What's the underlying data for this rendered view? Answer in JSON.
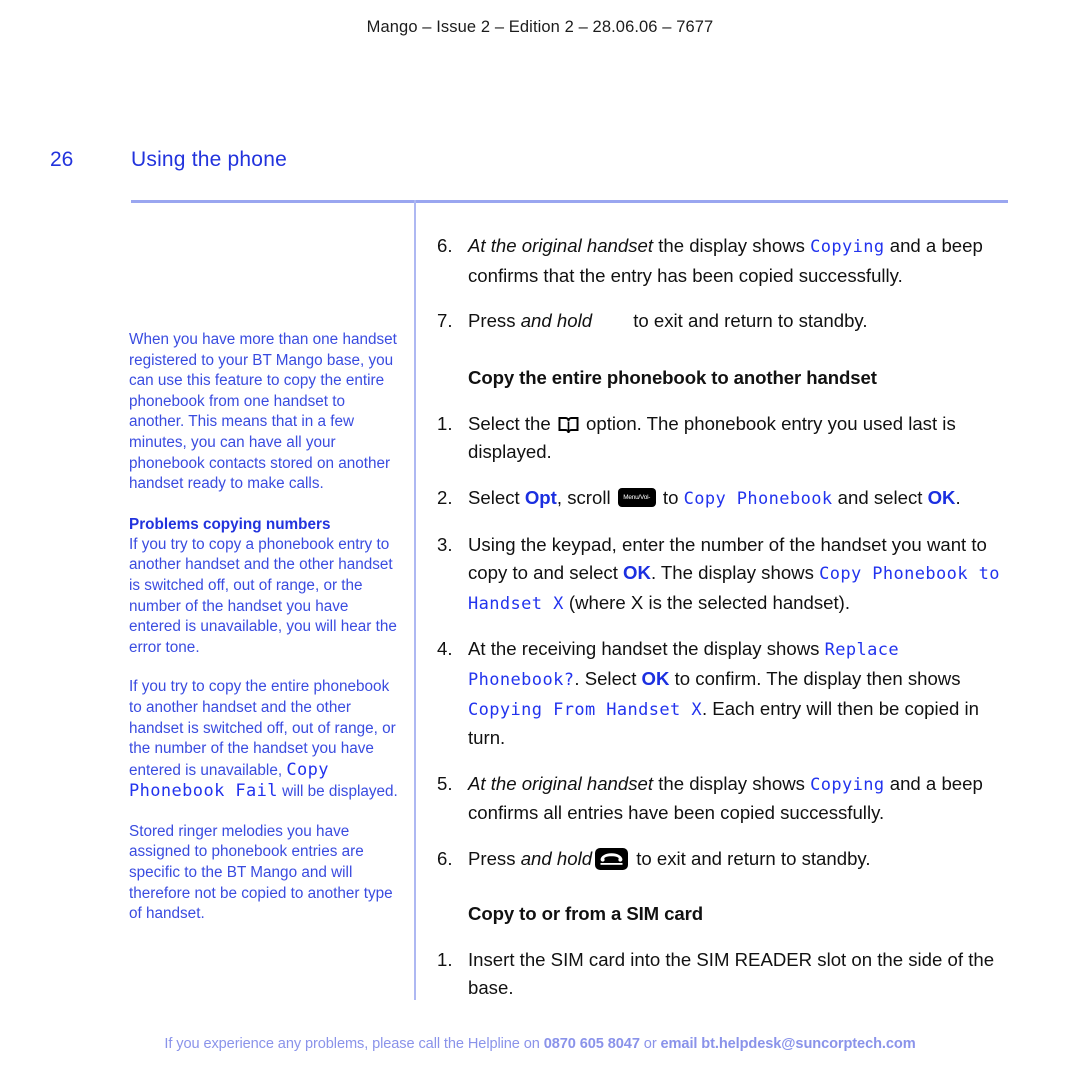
{
  "header": {
    "text": "Mango – Issue 2 – Edition 2 – 28.06.06 – 7677"
  },
  "title_row": {
    "page_number": "26",
    "title": "Using the phone"
  },
  "colors": {
    "accent_blue": "#2233dd",
    "lcd_blue": "#2233ee",
    "sidebar_blue": "#3a4ce0",
    "footer_blue": "#8a93ea",
    "rule_blue": "#9aa6f0"
  },
  "sidebar": {
    "intro": "When you have more than one handset registered to your BT Mango base, you can use this feature to copy the entire phonebook from one handset to another. This means that in a few minutes, you can have all your phonebook contacts stored on another handset ready to make calls.",
    "problems_heading": "Problems copying numbers",
    "problems_para": "If you try to copy a phonebook entry to another handset and the other handset is switched off, out of range, or the number of the handset you have entered is unavailable, you will hear the error tone.",
    "entire_para_pre": "If you try to copy the entire phonebook to another handset and the other handset is switched off, out of range, or the number of the handset you have entered is unavailable, ",
    "entire_para_lcd": "Copy Phonebook Fail",
    "entire_para_post": " will be displayed.",
    "melodies_para": "Stored ringer melodies you have assigned to phonebook entries are specific to the BT Mango and will therefore not be copied to another type of handset."
  },
  "main": {
    "step6_num": "6.",
    "step6_italic": "At the original handset",
    "step6_pre": " the display shows ",
    "step6_lcd": "Copying",
    "step6_post": " and a beep confirms that the entry has been copied successfully.",
    "step7_num": "7.",
    "step7_pre": "Press ",
    "step7_italic": "and hold",
    "step7_post": " to exit and return to standby.",
    "heading_entire": "Copy the entire phonebook to another handset",
    "e1_num": "1.",
    "e1_pre": "Select the ",
    "e1_post": " option. The phonebook entry you used last is displayed.",
    "e1_icon": "phonebook-book-icon",
    "e2_num": "2.",
    "e2_a": "Select ",
    "e2_opt": "Opt",
    "e2_b": ", scroll ",
    "e2_icon_label": "Menu/Vol-",
    "e2_c": " to ",
    "e2_lcd": "Copy Phonebook",
    "e2_d": " and select ",
    "e2_ok": "OK",
    "e2_e": ".",
    "e3_num": "3.",
    "e3_a": "Using the keypad, enter the number of the handset you want to copy to and select ",
    "e3_ok": "OK",
    "e3_b": ". The display shows ",
    "e3_lcd": "Copy Phonebook to Handset X",
    "e3_c": " (where X is the selected handset).",
    "e4_num": "4.",
    "e4_a": "At the receiving handset the display shows ",
    "e4_lcd1": "Replace Phonebook?",
    "e4_b": ". Select ",
    "e4_ok": "OK",
    "e4_c": " to confirm. The display then shows ",
    "e4_lcd2": "Copying From Handset X",
    "e4_d": ". Each entry will then be copied in turn.",
    "e5_num": "5.",
    "e5_italic": "At the original handset",
    "e5_pre": " the display shows ",
    "e5_lcd": "Copying",
    "e5_post": " and a beep confirms all entries have been copied successfully.",
    "e6_num": "6.",
    "e6_pre": "Press ",
    "e6_italic": "and hold",
    "e6_post": " to exit and return to standby.",
    "heading_sim": "Copy to or from a SIM card",
    "s1_num": "1.",
    "s1_text": "Insert the SIM card into the SIM READER slot on the side of the base."
  },
  "footer": {
    "pre": "If you experience any problems, please call the Helpline on ",
    "phone": "0870 605 8047",
    "mid": " or ",
    "email": "email bt.helpdesk@suncorptech.com"
  }
}
